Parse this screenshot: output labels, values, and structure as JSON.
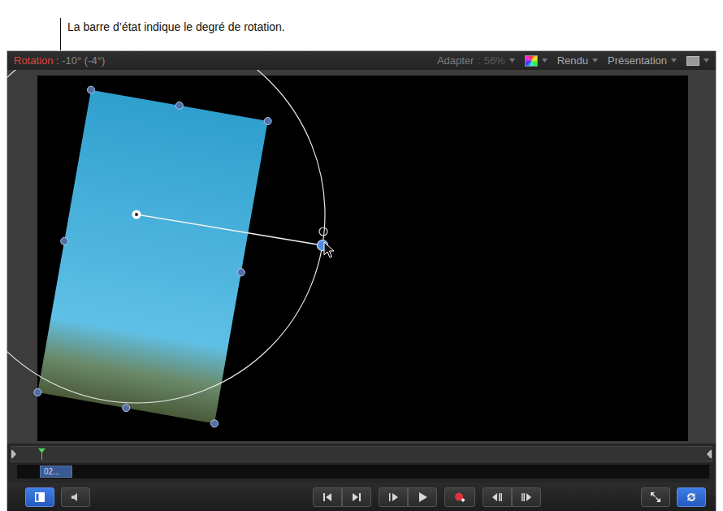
{
  "callout": {
    "text": "La barre d’état indique le degré de rotation."
  },
  "status_bar": {
    "label": "Rotation",
    "value": " : -10° (-4°)"
  },
  "menus": [
    {
      "kind": "zoom",
      "label": "Adapter",
      "value": " : 56%"
    },
    {
      "kind": "color"
    },
    {
      "kind": "text",
      "label": "Rendu"
    },
    {
      "kind": "text",
      "label": "Présentation"
    },
    {
      "kind": "view"
    }
  ],
  "timeline": {
    "clip": "02...",
    "playhead": 0.03
  },
  "transport": {
    "left": [
      {
        "selected": true
      },
      {
        "selected": false
      }
    ],
    "center": [
      [
        {
          "selected": false
        },
        {
          "selected": false
        }
      ],
      [
        {
          "selected": false
        },
        {
          "selected": false
        }
      ],
      [
        {
          "selected": false
        }
      ],
      [
        {
          "selected": false
        },
        {
          "selected": false
        }
      ]
    ],
    "right": [
      {
        "selected": false
      },
      {
        "selected": true
      }
    ]
  }
}
